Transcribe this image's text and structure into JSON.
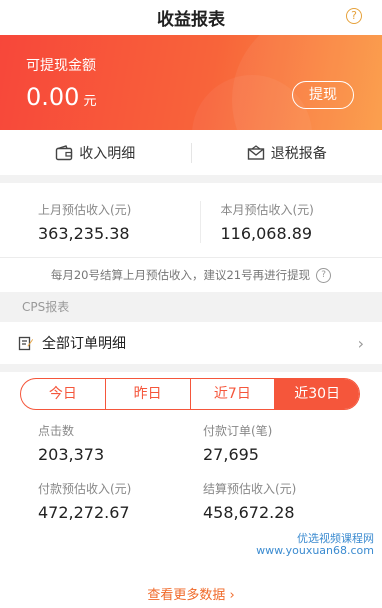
{
  "header": {
    "title": "收益报表",
    "help_icon": "question-circle-icon"
  },
  "balance": {
    "label": "可提现金额",
    "amount": "0.00",
    "unit": "元",
    "withdraw_label": "提现",
    "colors": {
      "start": "#f7473a",
      "end": "#fb9a43"
    }
  },
  "actions": {
    "income_detail": "收入明细",
    "tax_refund": "退税报备"
  },
  "stats": {
    "last_month_label": "上月预估收入(元)",
    "last_month_value": "363,235.38",
    "this_month_label": "本月预估收入(元)",
    "this_month_value": "116,068.89"
  },
  "notice": {
    "text": "每月20号结算上月预估收入，建议21号再进行提现"
  },
  "cps": {
    "section_label": "CPS报表",
    "all_orders_label": "全部订单明细"
  },
  "tabs": {
    "items": [
      "今日",
      "昨日",
      "近7日",
      "近30日"
    ],
    "active": "近30日",
    "accent": "#f5563b"
  },
  "metrics": {
    "clicks_label": "点击数",
    "clicks_value": "203,373",
    "paid_orders_label": "付款订单(笔)",
    "paid_orders_value": "27,695",
    "paid_income_label": "付款预估收入(元)",
    "paid_income_value": "472,272.67",
    "settle_income_label": "结算预估收入(元)",
    "settle_income_value": "458,672.28"
  },
  "more_link": "查看更多数据",
  "watermark": {
    "line1": "优选视频课程网",
    "line2": "www.youxuan68.com"
  }
}
